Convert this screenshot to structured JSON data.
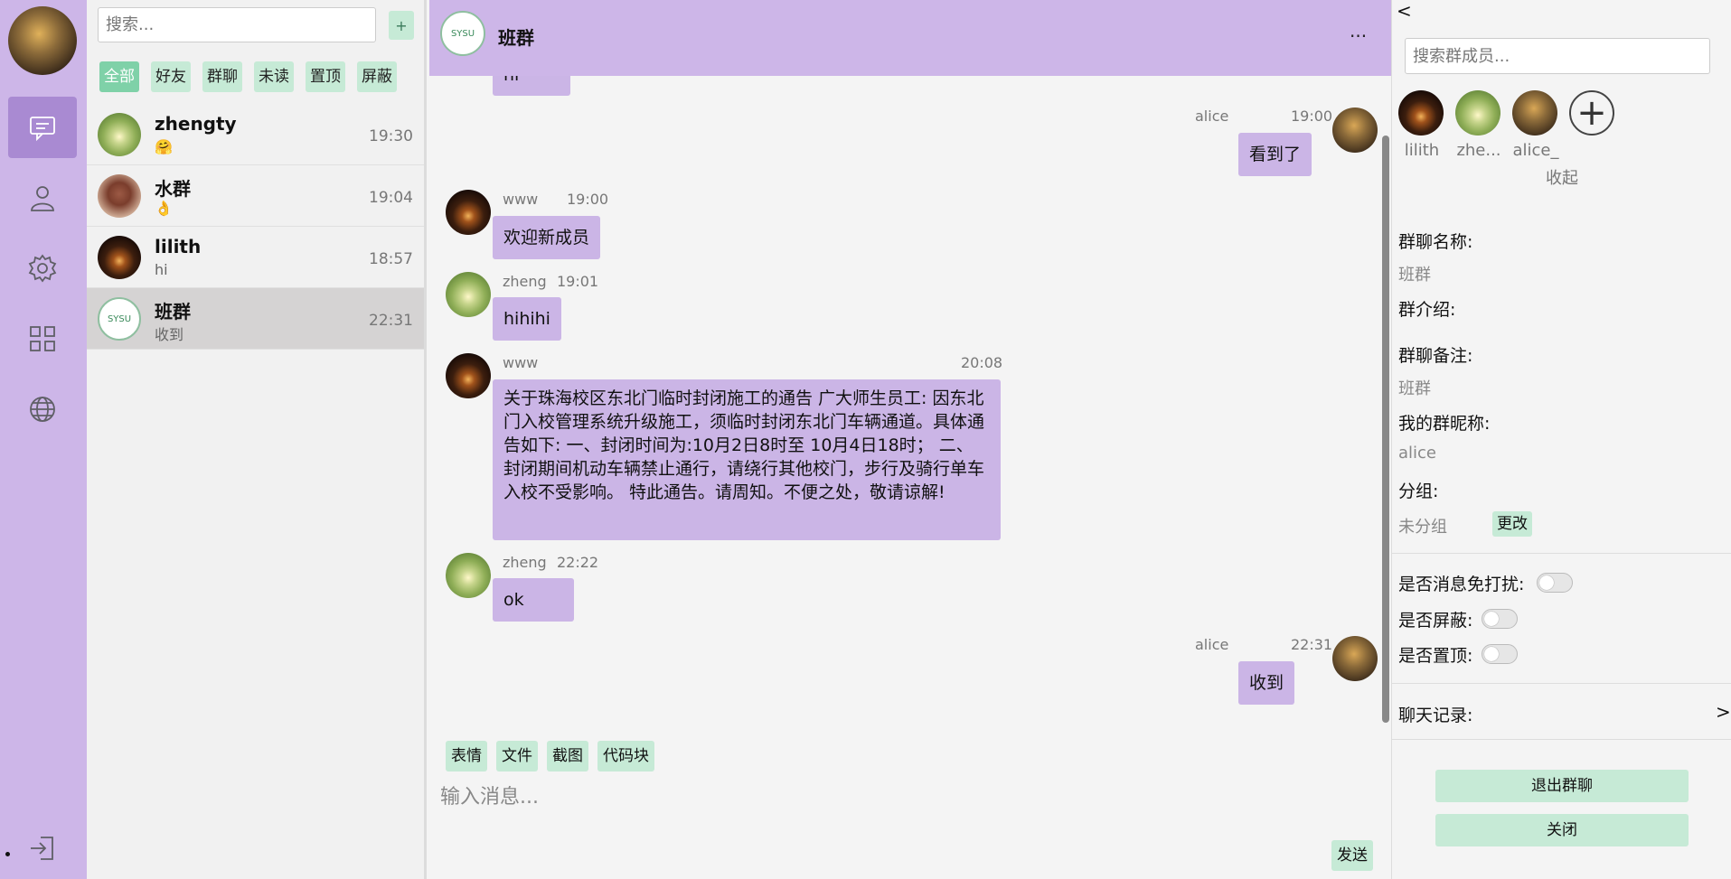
{
  "nav": {
    "items": [
      "chat",
      "contacts",
      "settings",
      "apps",
      "globe"
    ],
    "logout_icon": "logout-icon"
  },
  "list": {
    "search_placeholder": "搜索...",
    "add_label": "+",
    "filters": [
      "全部",
      "好友",
      "群聊",
      "未读",
      "置顶",
      "屏蔽"
    ],
    "conversations": [
      {
        "name": "zhengty",
        "preview": "🤗",
        "time": "19:30"
      },
      {
        "name": "水群",
        "preview": "👌",
        "time": "19:04"
      },
      {
        "name": "lilith",
        "preview": "hi",
        "time": "18:57"
      },
      {
        "name": "班群",
        "preview": "收到",
        "time": "22:31"
      }
    ]
  },
  "chat": {
    "title": "班群",
    "more": "...",
    "logo_text": "SYSU",
    "messages": [
      {
        "sender": "",
        "time": "",
        "text": "hi"
      },
      {
        "sender": "alice",
        "time": "19:00",
        "text": "看到了"
      },
      {
        "sender": "www",
        "time": "19:00",
        "text": "欢迎新成员"
      },
      {
        "sender": "zheng",
        "time": "19:01",
        "text": "hihihi"
      },
      {
        "sender": "www",
        "time": "20:08",
        "text": "关于珠海校区东北门临时封闭施工的通告 广大师生员工: 因东北门入校管理系统升级施工，须临时封闭东北门车辆通道。具体通告如下: 一、封闭时间为:10月2日8时至 10月4日18时；  二、封闭期间机动车辆禁止通行，请绕行其他校门，步行及骑行单车入校不受影响。 特此通告。请周知。不便之处，敬请谅解!"
      },
      {
        "sender": "zheng",
        "time": "22:22",
        "text": "ok"
      },
      {
        "sender": "alice",
        "time": "22:31",
        "text": "收到"
      }
    ],
    "tools": [
      "表情",
      "文件",
      "截图",
      "代码块"
    ],
    "input_placeholder": "输入消息...",
    "send_label": "发送"
  },
  "panel": {
    "back": "<",
    "search_placeholder": "搜索群成员...",
    "members": [
      "lilith",
      "zhe...",
      "alice_"
    ],
    "collapse_label": "收起",
    "group_name_label": "群聊名称:",
    "group_name": "班群",
    "intro_label": "群介绍:",
    "remark_label": "群聊备注:",
    "remark": "班群",
    "nickname_label": "我的群昵称:",
    "nickname": "alice",
    "group_label": "分组:",
    "group_value": "未分组",
    "change_label": "更改",
    "mute_label": "是否消息免打扰:",
    "block_label": "是否屏蔽:",
    "pin_label": "是否置顶:",
    "history_label": "聊天记录:",
    "history_arrow": ">",
    "leave_label": "退出群聊",
    "close_label": "关闭"
  }
}
